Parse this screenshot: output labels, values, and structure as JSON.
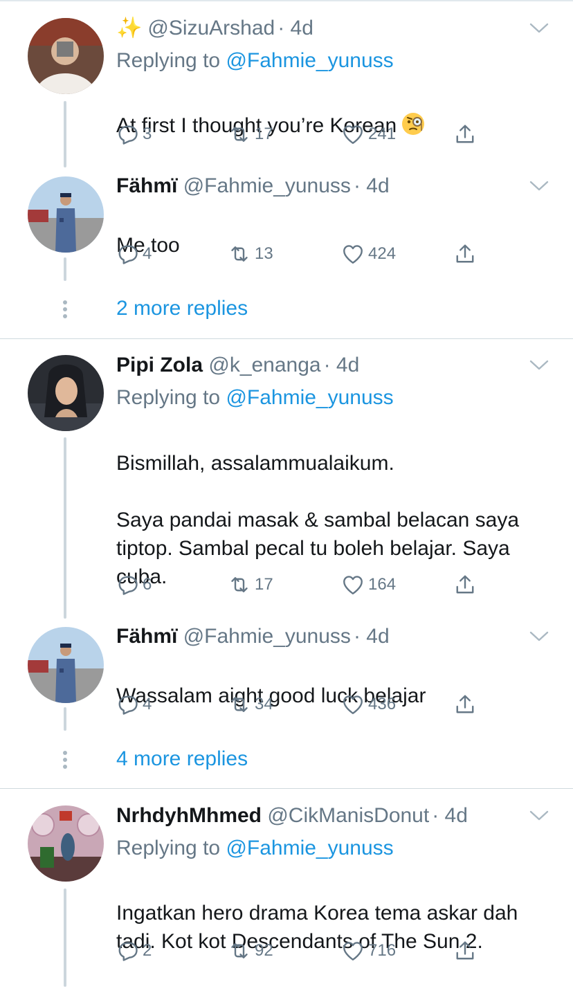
{
  "tweets": [
    {
      "sparkles": "✨",
      "name": "",
      "handle": "@SizuArshad",
      "time": "· 4d",
      "replying_prefix": "Replying to",
      "replying_handle": "@Fahmie_yunuss",
      "text": "At first I thought you’re Korean",
      "emoji": "monocle-face",
      "replies": "3",
      "retweets": "17",
      "likes": "241"
    },
    {
      "name": "Fähmï",
      "handle": "@Fahmie_yunuss",
      "time": "· 4d",
      "text": "Me too",
      "replies": "4",
      "retweets": "13",
      "likes": "424"
    },
    {
      "name": "Pipi Zola",
      "handle": "@k_enanga",
      "time": "· 4d",
      "replying_prefix": "Replying to",
      "replying_handle": "@Fahmie_yunuss",
      "text": "Bismillah, assalammualaikum.\n\nSaya pandai masak & sambal belacan saya tiptop. Sambal pecal tu boleh belajar. Saya cuba.",
      "replies": "6",
      "retweets": "17",
      "likes": "164"
    },
    {
      "name": "Fähmï",
      "handle": "@Fahmie_yunuss",
      "time": "· 4d",
      "text": "Wassalam aight good luck belajar",
      "replies": "4",
      "retweets": "34",
      "likes": "436"
    },
    {
      "name": "NrhdyhMhmed",
      "handle": "@CikManisDonut",
      "time": "· 4d",
      "replying_prefix": "Replying to",
      "replying_handle": "@Fahmie_yunuss",
      "text": "Ingatkan hero drama Korea tema askar dah tadi. Kot kot Descendants of The Sun 2.",
      "replies": "2",
      "retweets": "92",
      "likes": "716"
    }
  ],
  "more_replies": [
    "2 more replies",
    "4 more replies"
  ],
  "colors": {
    "link": "#1b95e0",
    "secondary_text": "#657786",
    "primary_text": "#14171a",
    "thread_line": "#ccd6dd"
  },
  "icons": [
    "reply-icon",
    "retweet-icon",
    "like-icon",
    "share-icon",
    "chevron-down-icon"
  ]
}
